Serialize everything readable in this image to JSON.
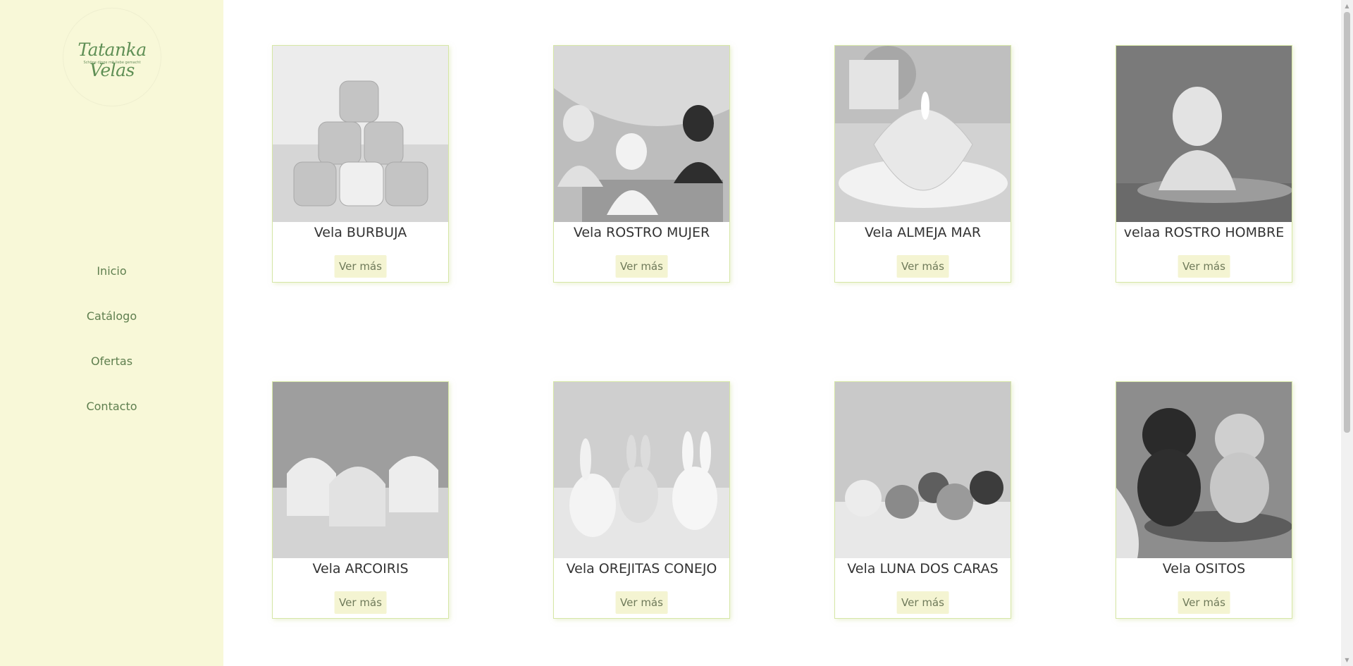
{
  "brand": {
    "name": "Tatanka Velas",
    "tagline": "Schöne dinge mit liebe gemacht"
  },
  "nav": [
    {
      "label": "Inicio"
    },
    {
      "label": "Catálogo"
    },
    {
      "label": "Ofertas"
    },
    {
      "label": "Contacto"
    }
  ],
  "products": [
    {
      "title": "Vela BURBUJA",
      "button": "Ver más"
    },
    {
      "title": "Vela ROSTRO MUJER",
      "button": "Ver más"
    },
    {
      "title": "Vela ALMEJA MAR",
      "button": "Ver más"
    },
    {
      "title": "velaa ROSTRO HOMBRE",
      "button": "Ver más"
    },
    {
      "title": "Vela ARCOIRIS",
      "button": "Ver más"
    },
    {
      "title": "Vela OREJITAS CONEJO",
      "button": "Ver más"
    },
    {
      "title": "Vela LUNA DOS CARAS",
      "button": "Ver más"
    },
    {
      "title": "Vela OSITOS",
      "button": "Ver más"
    }
  ],
  "colors": {
    "sidebar_bg": "#f8f8d8",
    "nav_text": "#5f7f4f",
    "card_border": "#d5e6a6",
    "button_bg": "#f4f4d2",
    "logo_green": "#5f8f55"
  }
}
